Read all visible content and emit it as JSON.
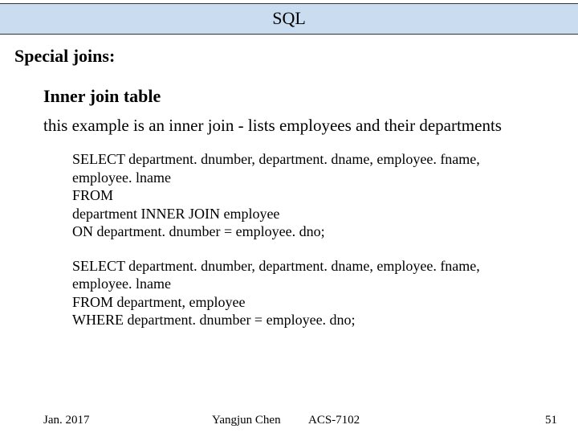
{
  "title": "SQL",
  "section_heading": "Special joins:",
  "subheading": "Inner join table",
  "description": "this example is an inner join - lists employees and their departments",
  "code1": {
    "l1": "SELECT department. dnumber, department. dname, employee. fname,",
    "l2": "employee. lname",
    "l3": "FROM",
    "l4": "department INNER JOIN employee",
    "l5": "ON department. dnumber = employee. dno;"
  },
  "code2": {
    "l1": "SELECT department. dnumber, department. dname, employee. fname,",
    "l2": "employee. lname",
    "l3": "FROM department, employee",
    "l4": "WHERE department. dnumber = employee. dno;"
  },
  "footer": {
    "date": "Jan. 2017",
    "author": "Yangjun Chen",
    "course": "ACS-7102",
    "page": "51"
  }
}
